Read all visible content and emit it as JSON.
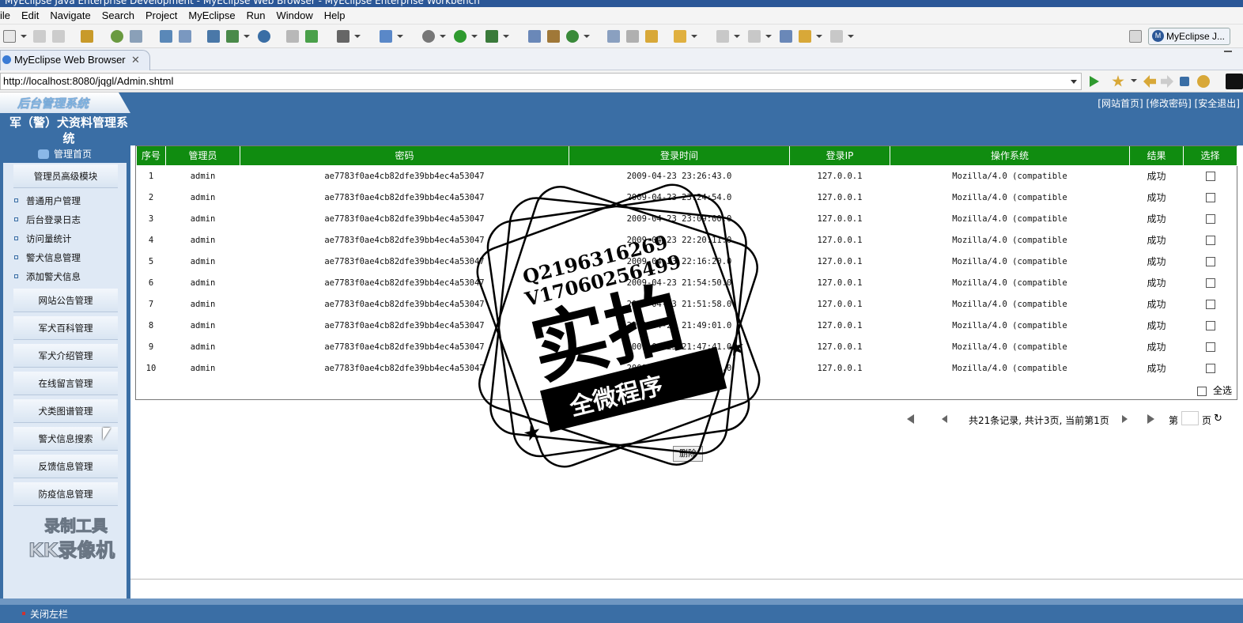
{
  "window": {
    "title": "MyEclipse Java Enterprise Development - MyEclipse Web Browser - MyEclipse Enterprise Workbench"
  },
  "menu": [
    "ile",
    "Edit",
    "Navigate",
    "Search",
    "Project",
    "MyEclipse",
    "Run",
    "Window",
    "Help"
  ],
  "toolbar": {
    "perspective_label": "MyEclipse J...",
    "perspective_icon": "M"
  },
  "tab": {
    "label": "MyEclipse Web Browser",
    "close": "✕"
  },
  "browser": {
    "url": "http://localhost:8080/jqgl/Admin.shtml"
  },
  "header": {
    "logo": "后台管理系统",
    "system_title": "军（警）犬资料管理系统",
    "top_links": "[网站首页] [修改密码] [安全退出]"
  },
  "sidebar": {
    "home": "管理首页",
    "sections": [
      {
        "label": "管理员高级模块"
      },
      {
        "label": "网站公告管理"
      },
      {
        "label": "军犬百科管理"
      },
      {
        "label": "军犬介绍管理"
      },
      {
        "label": "在线留言管理"
      },
      {
        "label": "犬类图谱管理"
      },
      {
        "label": "警犬信息搜索"
      },
      {
        "label": "反馈信息管理"
      },
      {
        "label": "防疫信息管理"
      }
    ],
    "subitems": [
      "普通用户管理",
      "后台登录日志",
      "访问量统计",
      "警犬信息管理",
      "添加警犬信息"
    ],
    "watermark_line1": "录制工具",
    "watermark_line2": "KK录像机"
  },
  "table": {
    "columns": [
      "序号",
      "管理员",
      "密码",
      "登录时间",
      "登录IP",
      "操作系统",
      "结果",
      "选择"
    ],
    "rows": [
      [
        "1",
        "admin",
        "ae7783f0ae4cb82dfe39bb4ec4a53047",
        "2009-04-23 23:26:43.0",
        "127.0.0.1",
        "Mozilla/4.0 (compatible",
        "成功"
      ],
      [
        "2",
        "admin",
        "ae7783f0ae4cb82dfe39bb4ec4a53047",
        "2009-04-23 23:24:54.0",
        "127.0.0.1",
        "Mozilla/4.0 (compatible",
        "成功"
      ],
      [
        "3",
        "admin",
        "ae7783f0ae4cb82dfe39bb4ec4a53047",
        "2009-04-23 23:09:00.0",
        "127.0.0.1",
        "Mozilla/4.0 (compatible",
        "成功"
      ],
      [
        "4",
        "admin",
        "ae7783f0ae4cb82dfe39bb4ec4a53047",
        "2009-04-23 22:20:11.0",
        "127.0.0.1",
        "Mozilla/4.0 (compatible",
        "成功"
      ],
      [
        "5",
        "admin",
        "ae7783f0ae4cb82dfe39bb4ec4a53047",
        "2009-04-23 22:16:20.0",
        "127.0.0.1",
        "Mozilla/4.0 (compatible",
        "成功"
      ],
      [
        "6",
        "admin",
        "ae7783f0ae4cb82dfe39bb4ec4a53047",
        "2009-04-23 21:54:50.0",
        "127.0.0.1",
        "Mozilla/4.0 (compatible",
        "成功"
      ],
      [
        "7",
        "admin",
        "ae7783f0ae4cb82dfe39bb4ec4a53047",
        "2009-04-23 21:51:58.0",
        "127.0.0.1",
        "Mozilla/4.0 (compatible",
        "成功"
      ],
      [
        "8",
        "admin",
        "ae7783f0ae4cb82dfe39bb4ec4a53047",
        "2009-04-23 21:49:01.0",
        "127.0.0.1",
        "Mozilla/4.0 (compatible",
        "成功"
      ],
      [
        "9",
        "admin",
        "ae7783f0ae4cb82dfe39bb4ec4a53047",
        "2009-04-23 21:47:41.0",
        "127.0.0.1",
        "Mozilla/4.0 (compatible",
        "成功"
      ],
      [
        "10",
        "admin",
        "ae7783f0ae4cb82dfe39bb4ec4a53047",
        "2009-04-23 21:45:52.0",
        "127.0.0.1",
        "Mozilla/4.0 (compatible",
        "成功"
      ]
    ],
    "select_all": "全选",
    "header_color": "#108c10"
  },
  "pager": {
    "info": "共21条记录, 共计3页, 当前第1页",
    "page_prefix": "第",
    "page_suffix": "页",
    "delete": "删除"
  },
  "status": {
    "close_sidebar": "关闭左栏"
  },
  "stamp": {
    "line1": "Q2196316269",
    "line2": "V17060256499",
    "big": "实拍",
    "banner": "全微程序"
  },
  "colors": {
    "header_blue": "#3a6ea5",
    "table_green": "#108c10"
  }
}
